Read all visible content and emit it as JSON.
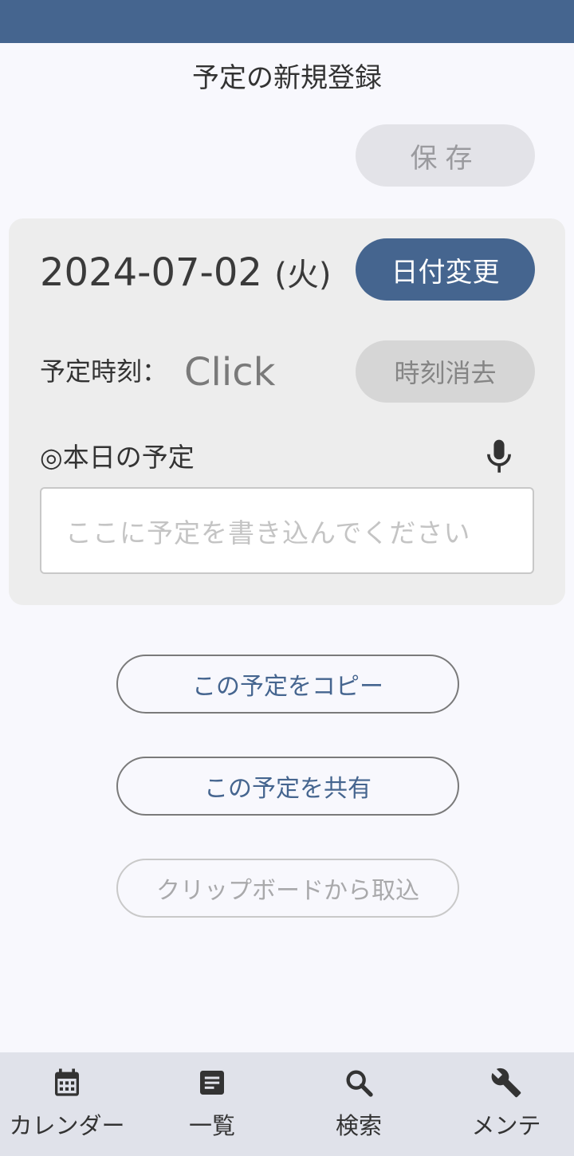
{
  "header": {
    "title": "予定の新規登録"
  },
  "toolbar": {
    "save_label": "保存"
  },
  "schedule": {
    "date": "2024-07-02",
    "weekday": "(火)",
    "date_change_label": "日付変更",
    "time_label": "予定時刻：",
    "time_value": "Click",
    "time_clear_label": "時刻消去",
    "section_label": "◎本日の予定",
    "input_placeholder": "ここに予定を書き込んでください",
    "input_value": ""
  },
  "actions": {
    "copy_label": "この予定をコピー",
    "share_label": "この予定を共有",
    "clipboard_label": "クリップボードから取込"
  },
  "nav": {
    "items": [
      {
        "label": "カレンダー",
        "icon": "calendar-icon"
      },
      {
        "label": "一覧",
        "icon": "list-icon"
      },
      {
        "label": "検索",
        "icon": "search-icon"
      },
      {
        "label": "メンテ",
        "icon": "wrench-icon"
      }
    ]
  },
  "colors": {
    "accent": "#45658f",
    "background": "#f8f8fd",
    "card": "#ededed",
    "nav_background": "#e0e2ea"
  }
}
